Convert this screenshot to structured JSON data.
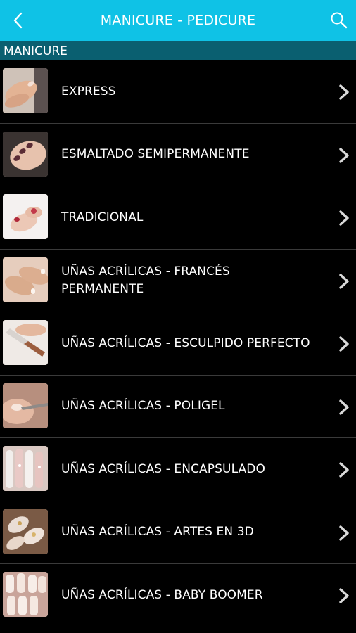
{
  "header": {
    "title": "MANICURE - PEDICURE",
    "back_icon": "chevron-left-icon",
    "search_icon": "search-icon",
    "background": "#0fc2e6"
  },
  "section": {
    "title": "MANICURE",
    "background": "#0a5f70"
  },
  "items": [
    {
      "label": "EXPRESS",
      "thumb": "express"
    },
    {
      "label": "ESMALTADO SEMIPERMANENTE",
      "thumb": "semipermanente"
    },
    {
      "label": "TRADICIONAL",
      "thumb": "tradicional"
    },
    {
      "label": "UÑAS ACRÍLICAS - FRANCÉS PERMANENTE",
      "thumb": "frances"
    },
    {
      "label": "UÑAS ACRÍLICAS - ESCULPIDO PERFECTO",
      "thumb": "esculpido"
    },
    {
      "label": "UÑAS ACRÍLICAS - POLIGEL",
      "thumb": "poligel"
    },
    {
      "label": "UÑAS ACRÍLICAS - ENCAPSULADO",
      "thumb": "encapsulado"
    },
    {
      "label": "UÑAS ACRÍLICAS - ARTES EN 3D",
      "thumb": "artes3d"
    },
    {
      "label": "UÑAS ACRÍLICAS - BABY BOOMER",
      "thumb": "babyboomer"
    }
  ]
}
